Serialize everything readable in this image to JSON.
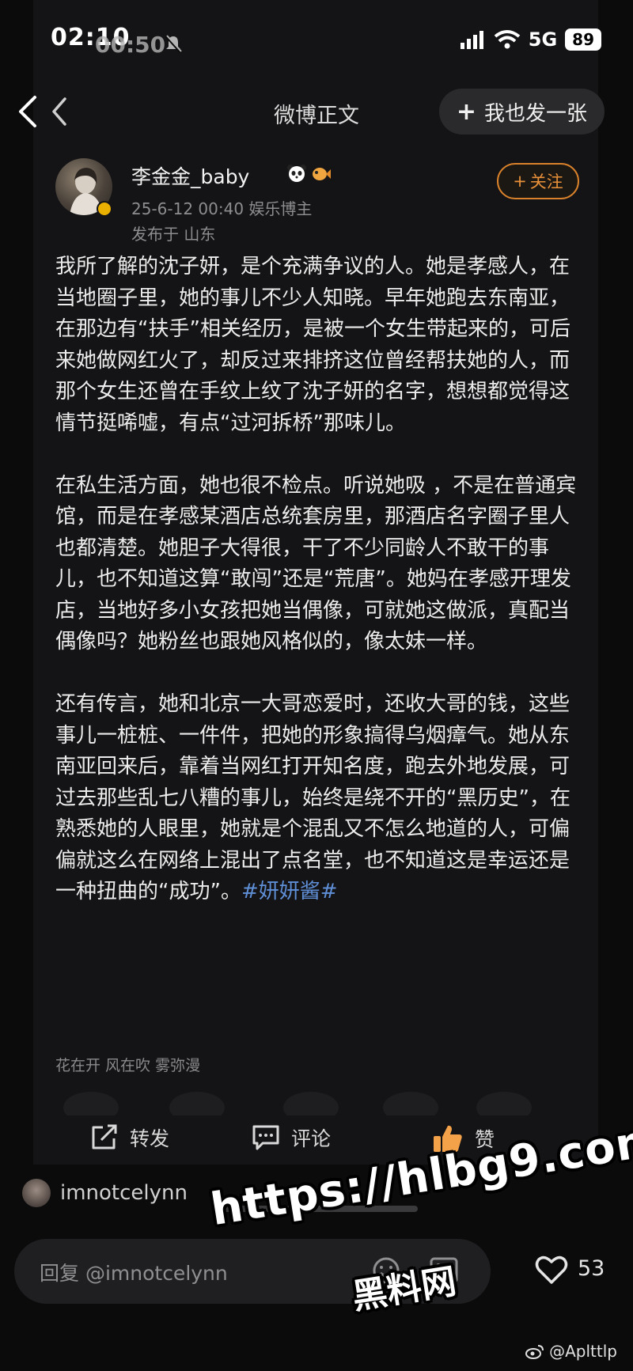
{
  "status_bar": {
    "time": "02:10",
    "time_ghost": "00:50",
    "network": "5G",
    "battery": "89"
  },
  "nav": {
    "title": "微博正文",
    "post_also_label": "我也发一张"
  },
  "post": {
    "username": "李金金_baby",
    "meta": "25-6-12 00:40  娱乐博主",
    "location": "发布于 山东",
    "follow_label": "关注",
    "paragraphs": [
      "我所了解的沈子妍，是个充满争议的人。她是孝感人，在当地圈子里，她的事儿不少人知晓。早年她跑去东南亚，在那边有“扶手”相关经历，是被一个女生带起来的，可后来她做网红火了，却反过来排挤这位曾经帮扶她的人，而那个女生还曾在手纹上纹了沈子妍的名字，想想都觉得这情节挺唏嘘，有点“过河拆桥”那味儿。",
      "在私生活方面，她也很不检点。听说她吸 ，不是在普通宾馆，而是在孝感某酒店总统套房里，那酒店名字圈子里人也都清楚。她胆子大得很，干了不少同龄人不敢干的事儿，也不知道这算“敢闯”还是“荒唐”。她妈在孝感开理发店，当地好多小女孩把她当偶像，可就她这做派，真配当偶像吗？她粉丝也跟她风格似的，像太妹一样。"
    ],
    "last_paragraph": "还有传言，她和北京一大哥恋爱时，还收大哥的钱，这些事儿一桩桩、一件件，把她的形象搞得乌烟瘴气。她从东南亚回来后，靠着当网红打开知名度，跑去外地发展，可过去那些乱七八糟的事儿，始终是绕不开的“黑历史”，在熟悉她的人眼里，她就是个混乱又不怎么地道的人，可偏偏就这么在网络上混出了点名堂，也不知道这是幸运还是一种扭曲的“成功”。",
    "hashtag": "#妍妍酱#",
    "tag_line": "花在开 风在吹 雾弥漫"
  },
  "actions": {
    "repost": "转发",
    "comment": "评论",
    "like": "赞"
  },
  "comment_area": {
    "commenter": "imnotcelynn",
    "reply_placeholder": "回复 @imnotcelynn",
    "like_count": "53"
  },
  "watermark": {
    "url": "https://hlbg9.com",
    "cn": "黑料网"
  },
  "source_mark": "@Aplttlp"
}
